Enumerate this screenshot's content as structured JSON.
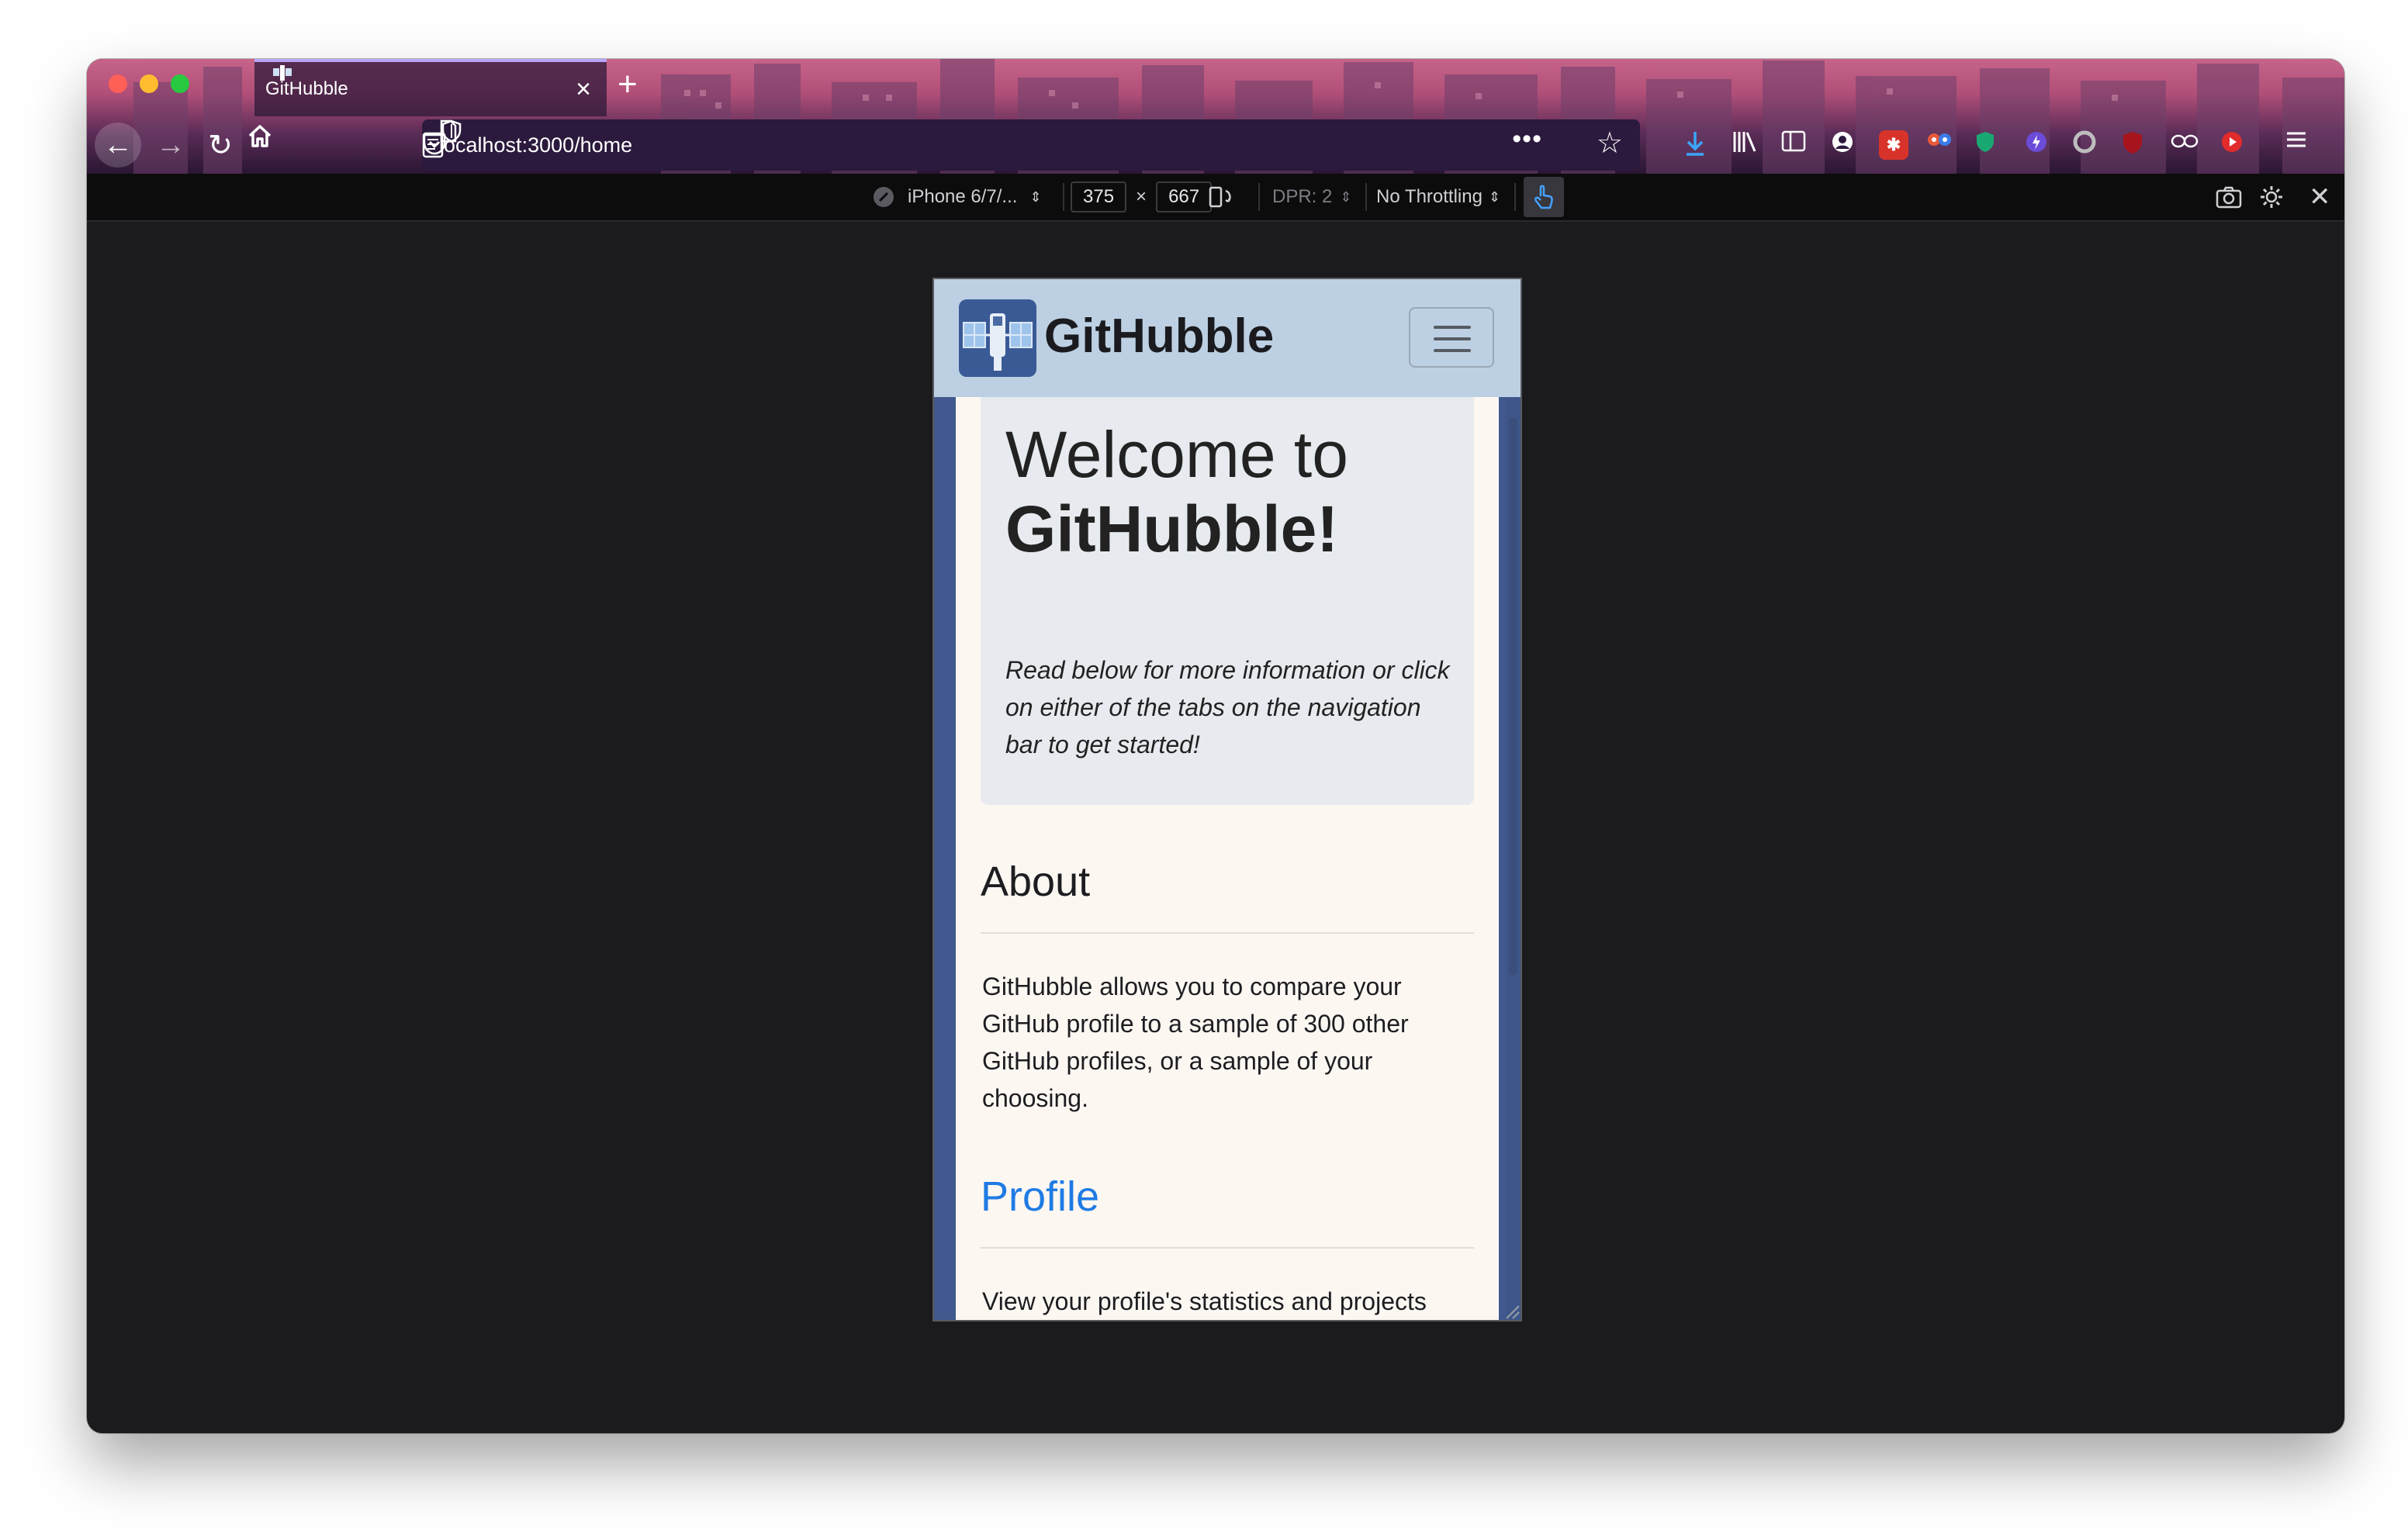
{
  "browser": {
    "tab_title": "GitHubble",
    "tab_close": "×",
    "new_tab": "+",
    "url": "localhost:3000/home"
  },
  "responsive_toolbar": {
    "device": "iPhone 6/7/...",
    "width": "375",
    "times": "×",
    "height": "667",
    "dpr": "DPR: 2",
    "throttling": "No Throttling"
  },
  "site": {
    "brand": "GitHubble",
    "hero_title_line1": "Welcome to",
    "hero_title_line2": "GitHubble!",
    "hero_text": "Read below for more information or click on either of the tabs on the navigation bar to get started!",
    "about_title": "About",
    "about_text": "GitHubble allows you to compare your GitHub profile to a sample of 300 other GitHub profiles, or a sample of your choosing.",
    "profile_title": "Profile",
    "profile_text": "View your profile's statistics and projects"
  },
  "colors": {
    "navbar_bg": "#bdd0e3",
    "page_bg": "#fdf7f2",
    "link": "#1f7be4",
    "frame": "#41598f"
  },
  "extension_icons": [
    "download-icon",
    "library-icon",
    "sidebar-icon",
    "account-icon",
    "extension-red-icon",
    "extension-eyes-icon",
    "extension-green-shield-icon",
    "extension-purple-icon",
    "extension-grey-icon",
    "ublock-icon",
    "extension-glasses-icon",
    "extension-red-play-icon",
    "menu-icon"
  ]
}
